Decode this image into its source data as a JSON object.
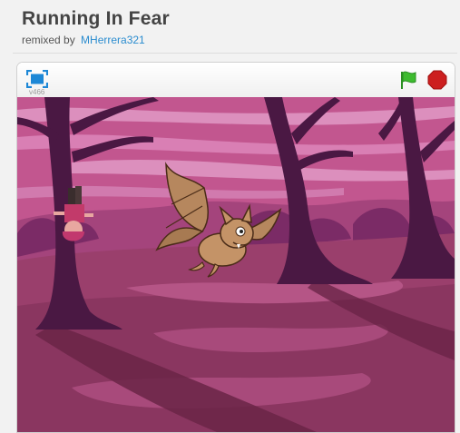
{
  "project": {
    "title": "Running In Fear",
    "remixed_by_label": "remixed by",
    "author": "MHerrera321"
  },
  "player": {
    "version": "v466",
    "fullscreen_icon": "fullscreen-icon",
    "green_flag_icon": "green-flag-icon",
    "stop_icon": "stop-icon"
  },
  "stage": {
    "scene": "purple-forest",
    "sprites": [
      "bat",
      "upside-down-character"
    ]
  },
  "colors": {
    "link": "#2a8ccf",
    "flag": "#3dbb2f",
    "stop": "#cc1f1f",
    "sky": "#c2568f",
    "ground": "#7d3456"
  }
}
